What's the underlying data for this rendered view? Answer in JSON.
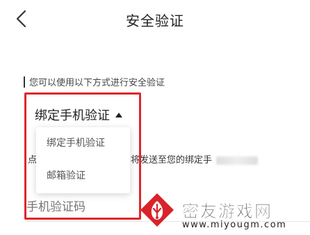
{
  "header": {
    "back_icon": "chevron-left-icon",
    "title": "安全验证"
  },
  "section": {
    "heading": "您可以使用以下方式进行安全验证"
  },
  "method_select": {
    "selected": "绑定手机验证",
    "caret_icon": "caret-up-icon"
  },
  "dropdown": {
    "options": [
      "绑定手机验证",
      "邮箱验证"
    ]
  },
  "background": {
    "hint_left": "点",
    "hint_text": "将发送至您的绑定手",
    "code_placeholder": "手机验证码"
  },
  "highlight_color": "#e0262b",
  "watermark": {
    "title": "密友游戏网",
    "url": "www.miyougm.com",
    "logo_color": "#d8232a"
  }
}
